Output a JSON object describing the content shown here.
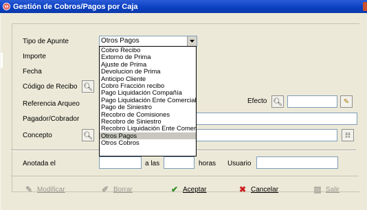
{
  "window": {
    "title": "Gestión de Cobros/Pagos por Caja"
  },
  "form": {
    "tipo_apunte_label": "Tipo de Apunte",
    "tipo_apunte_value": "Otros Pagos",
    "importe_label": "Importe",
    "fecha_label": "Fecha",
    "codigo_recibo_label": "Código de Recibo",
    "referencia_arqueo_label": "Referencia Arqueo",
    "efecto_label": "Efecto",
    "pagador_label": "Pagador/Cobrador",
    "concepto_label": "Concepto",
    "anotada_label": "Anotada el",
    "las_label": "a las",
    "horas_label": "horas",
    "usuario_label": "Usuario"
  },
  "dropdown": {
    "options": [
      "Cobro Recibo",
      "Extorno de Prima",
      "Ajuste de Prima",
      "Devolucion de Prima",
      "Anticipo Cliente",
      "Cobro Fracción recibo",
      "Pago Liquidación Compañía",
      "Pago Liquidación Ente Comercial",
      "Pago de Siniestro",
      "Recobro de Comisiones",
      "Recobro de Siniestro",
      "Recobro Liquidación Ente Comercial",
      "Otros Pagos",
      "Otros Cobros"
    ],
    "selected": "Otros Pagos"
  },
  "toolbar": {
    "modificar": "Modificar",
    "borrar": "Borrar",
    "aceptar": "Aceptar",
    "cancelar": "Cancelar",
    "salir": "Salir"
  },
  "colors": {
    "title_bar": "#0a3fc0",
    "window_bg": "#ece9d8",
    "accept_green": "#2a8a1e",
    "cancel_red": "#cc1f1f"
  }
}
